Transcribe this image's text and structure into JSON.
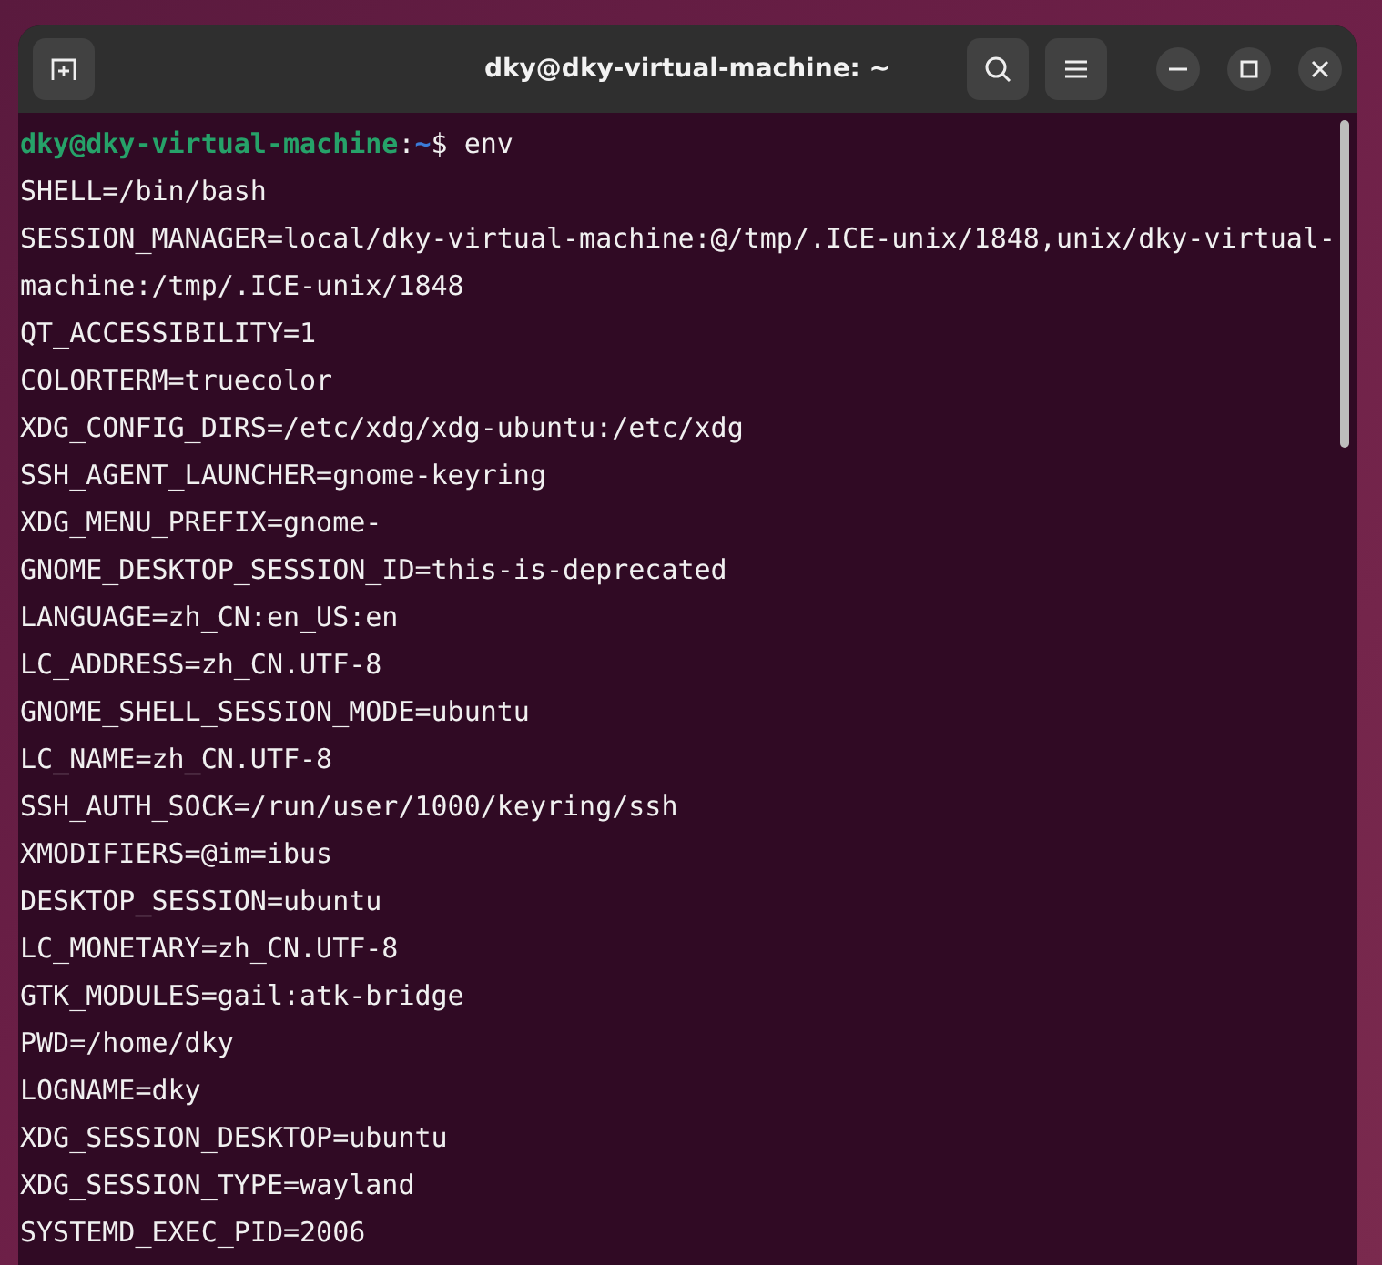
{
  "window": {
    "title": "dky@dky-virtual-machine: ~"
  },
  "prompt": [
    {
      "kind": "userhost",
      "text": "dky@dky-virtual-machine"
    },
    {
      "kind": "plain",
      "text": ":"
    },
    {
      "kind": "path",
      "text": "~"
    },
    {
      "kind": "plain",
      "text": "$ env"
    }
  ],
  "output": [
    "SHELL=/bin/bash",
    "SESSION_MANAGER=local/dky-virtual-machine:@/tmp/.ICE-unix/1848,unix/dky-virtual-",
    "machine:/tmp/.ICE-unix/1848",
    "QT_ACCESSIBILITY=1",
    "COLORTERM=truecolor",
    "XDG_CONFIG_DIRS=/etc/xdg/xdg-ubuntu:/etc/xdg",
    "SSH_AGENT_LAUNCHER=gnome-keyring",
    "XDG_MENU_PREFIX=gnome-",
    "GNOME_DESKTOP_SESSION_ID=this-is-deprecated",
    "LANGUAGE=zh_CN:en_US:en",
    "LC_ADDRESS=zh_CN.UTF-8",
    "GNOME_SHELL_SESSION_MODE=ubuntu",
    "LC_NAME=zh_CN.UTF-8",
    "SSH_AUTH_SOCK=/run/user/1000/keyring/ssh",
    "XMODIFIERS=@im=ibus",
    "DESKTOP_SESSION=ubuntu",
    "LC_MONETARY=zh_CN.UTF-8",
    "GTK_MODULES=gail:atk-bridge",
    "PWD=/home/dky",
    "LOGNAME=dky",
    "XDG_SESSION_DESKTOP=ubuntu",
    "XDG_SESSION_TYPE=wayland",
    "SYSTEMD_EXEC_PID=2006"
  ]
}
